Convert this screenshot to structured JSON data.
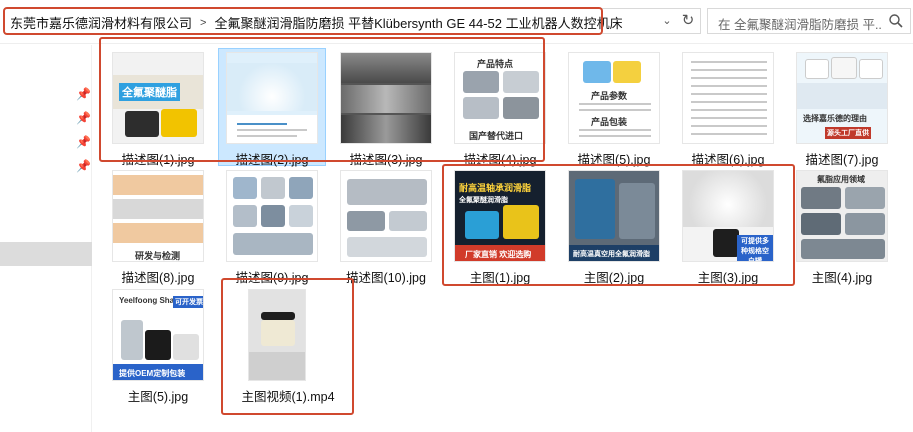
{
  "window": {
    "breadcrumb": [
      "东莞市嘉乐德润滑材料有限公司",
      "全氟聚醚润滑脂防磨损 平替Klübersynth GE 44-52 工业机器人数控机床"
    ],
    "search_placeholder": "在 全氟聚醚润滑脂防磨损 平..."
  },
  "files": [
    {
      "name": "描述图(1).jpg"
    },
    {
      "name": "描述图(2).jpg"
    },
    {
      "name": "描述图(3).jpg"
    },
    {
      "name": "描述图(4).jpg"
    },
    {
      "name": "描述图(5).jpg"
    },
    {
      "name": "描述图(6).jpg"
    },
    {
      "name": "描述图(7).jpg"
    },
    {
      "name": "描述图(8).jpg"
    },
    {
      "name": "描述图(9).jpg"
    },
    {
      "name": "描述图(10).jpg"
    },
    {
      "name": "主图(1).jpg"
    },
    {
      "name": "主图(2).jpg"
    },
    {
      "name": "主图(3).jpg"
    },
    {
      "name": "主图(4).jpg"
    },
    {
      "name": "主图(5).jpg"
    },
    {
      "name": "主图视频(1).mp4"
    }
  ],
  "thumb_text": {
    "t1_brand": "全氟聚醚脂",
    "t4_title": "产品特点",
    "t4_footer": "国产替代进口",
    "t5_title": "产品参数",
    "t5_sub": "产品包装",
    "t7_title": "选择嘉乐德的理由",
    "t7_sub": "源头工厂直供",
    "t8_caption": "研发与检测",
    "t11_title": "耐高温轴承润滑脂",
    "t11_sub": "全氟聚醚润滑脂",
    "t11_footer": "厂家直销 欢迎选购",
    "t12_footer": "耐高温真空用全氟润滑脂",
    "t13_tag": "可提供多种规格空白罐",
    "t14_title": "氟脂应用领域",
    "t15_brand": "Yeelfoong Shao",
    "t15_tag": "可开发票",
    "t15_footer": "提供OEM定制包装"
  },
  "selected_file_index": 1
}
